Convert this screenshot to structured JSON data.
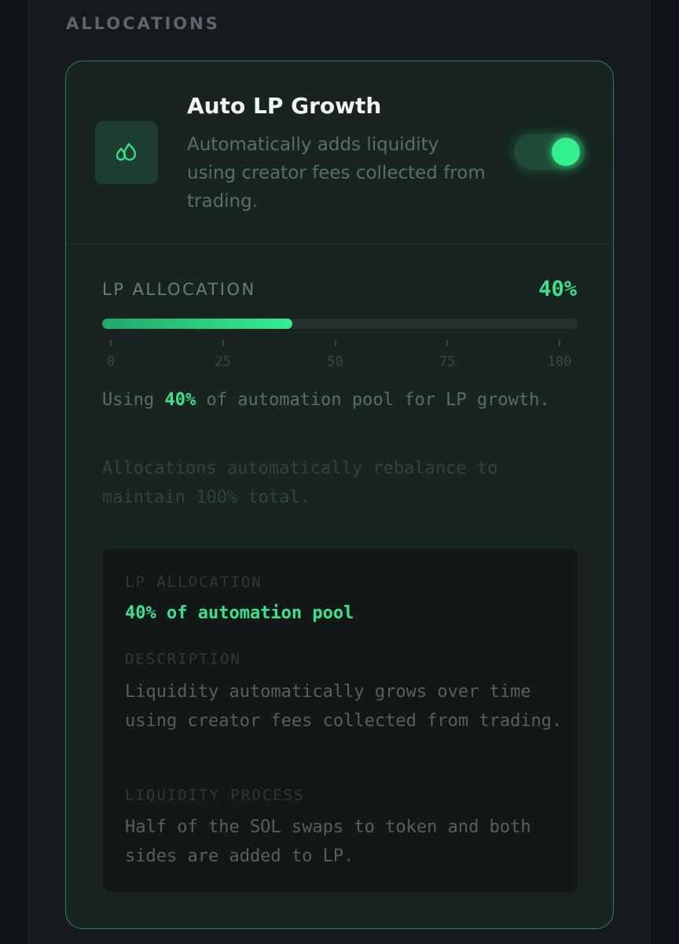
{
  "section": {
    "title": "ALLOCATIONS"
  },
  "card": {
    "icon": "droplets-icon",
    "title": "Auto LP Growth",
    "description": "Automatically adds liquidity using creator fees collected from trading.",
    "toggle_on": true
  },
  "allocation": {
    "label": "LP ALLOCATION",
    "value_text": "40%",
    "value": 40,
    "scale": [
      "0",
      "25",
      "50",
      "75",
      "100"
    ],
    "using_prefix": "Using ",
    "using_value": "40%",
    "using_suffix": " of automation pool for LP growth.",
    "rebalance_note": "Allocations automatically rebalance to maintain 100% total."
  },
  "info": {
    "lp_key": "LP ALLOCATION",
    "lp_value": "40% of automation pool",
    "desc_key": "DESCRIPTION",
    "desc_value": "Liquidity automatically grows over time using creator fees collected from trading.",
    "process_key": "LIQUIDITY PROCESS",
    "process_value": "Half of the SOL swaps to token and both sides are added to LP."
  },
  "colors": {
    "accent": "#37e58c",
    "card_border": "#2b7f57"
  }
}
